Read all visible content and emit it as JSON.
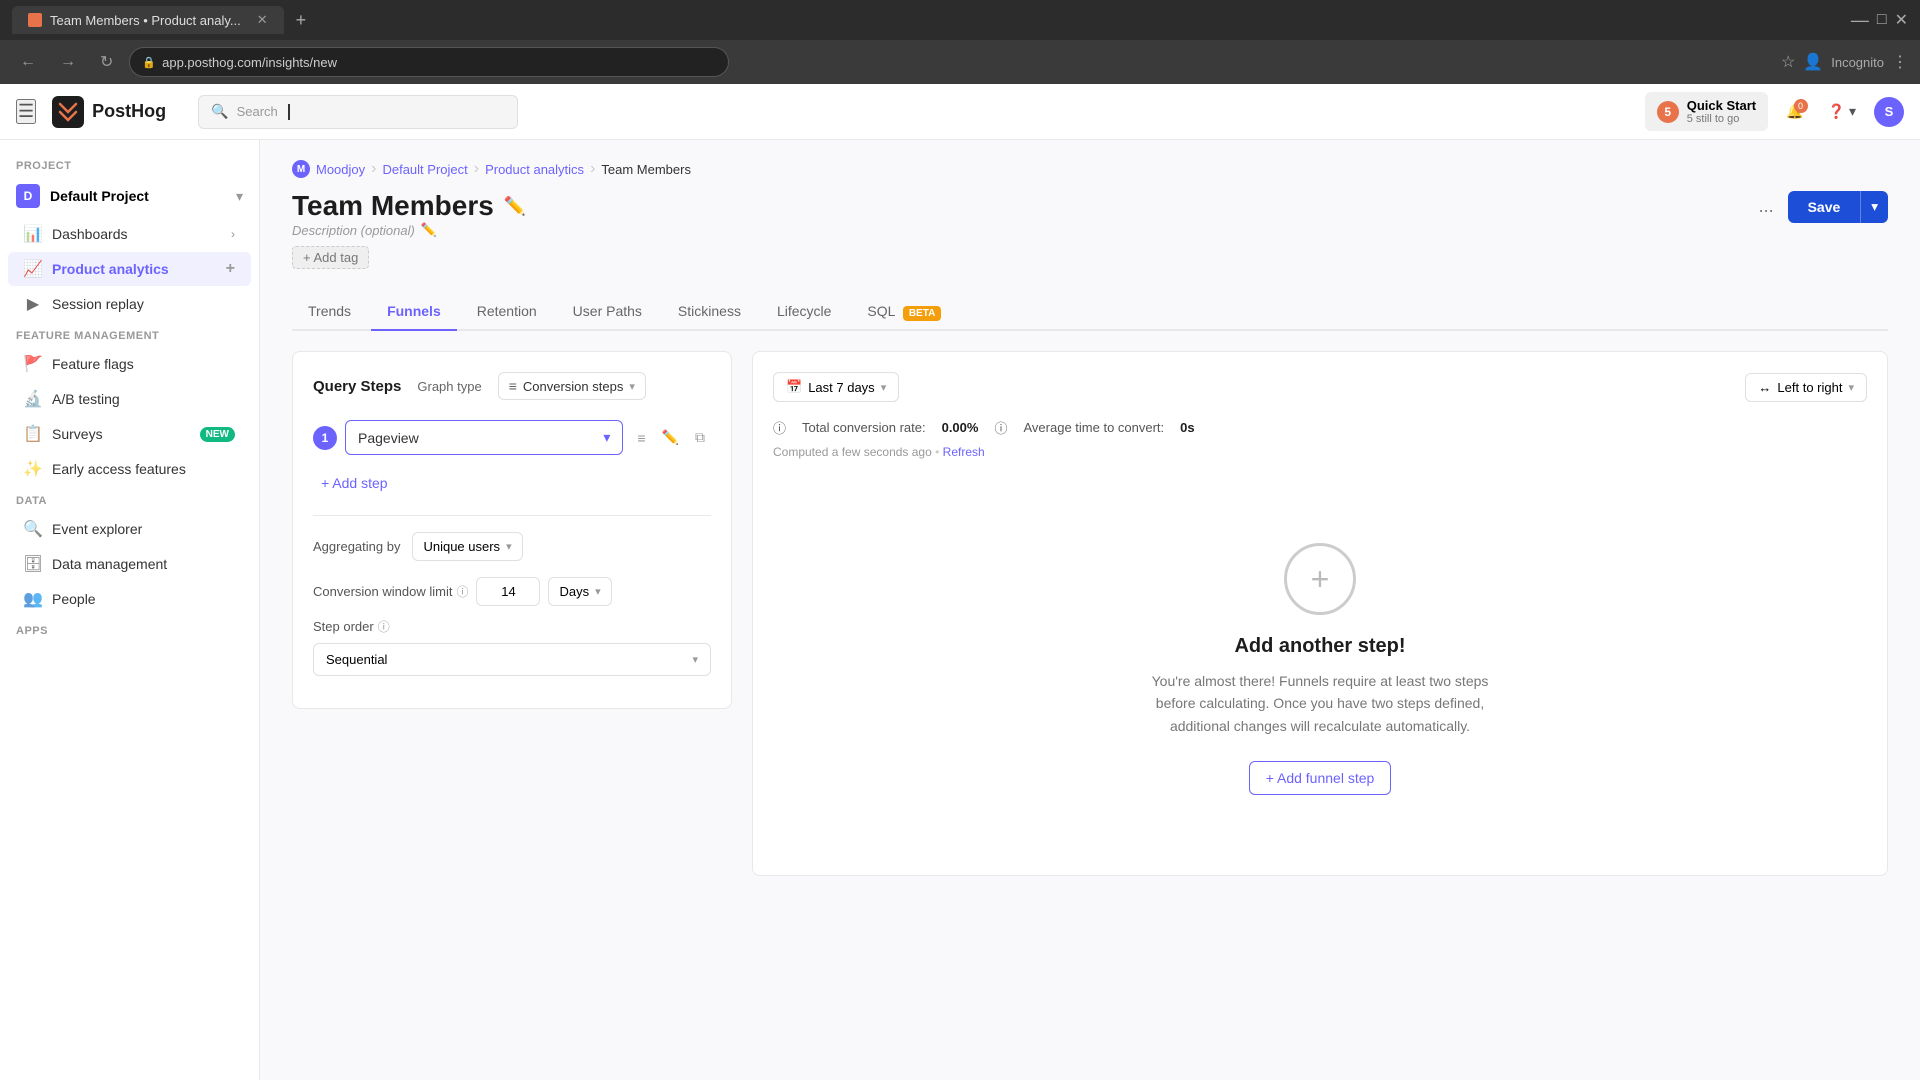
{
  "browser": {
    "tab_title": "Team Members • Product analy...",
    "address": "app.posthog.com/insights/new",
    "incognito_label": "Incognito"
  },
  "topbar": {
    "logo_text": "PostHog",
    "search_placeholder": "Search...",
    "search_label": "Search",
    "quick_start_label": "Quick Start",
    "quick_start_sub": "5 still to go",
    "quick_start_count": "5",
    "notification_count": "0",
    "help_label": "Help",
    "avatar_initials": "S"
  },
  "sidebar": {
    "project_section": "PROJECT",
    "project_name": "Default Project",
    "project_initial": "D",
    "nav_items": [
      {
        "id": "dashboards",
        "label": "Dashboards",
        "icon": "📊"
      },
      {
        "id": "product-analytics",
        "label": "Product analytics",
        "icon": "📈",
        "active": true
      }
    ],
    "session_replay": {
      "label": "Session replay",
      "icon": "▶"
    },
    "feature_management_section": "FEATURE MANAGEMENT",
    "feature_flags": {
      "label": "Feature flags",
      "icon": "🚩"
    },
    "ab_testing": {
      "label": "A/B testing",
      "icon": "🔬"
    },
    "surveys": {
      "label": "Surveys",
      "icon": "📋",
      "badge": "NEW"
    },
    "early_access": {
      "label": "Early access features",
      "icon": "✨"
    },
    "data_section": "DATA",
    "event_explorer": {
      "label": "Event explorer",
      "icon": "🔍"
    },
    "data_management": {
      "label": "Data management",
      "icon": "🗄"
    },
    "people": {
      "label": "People",
      "icon": "👥"
    },
    "apps_section": "APPS"
  },
  "breadcrumb": {
    "project_icon": "M",
    "project_name": "Moodjoy",
    "default_project": "Default Project",
    "product_analytics": "Product analytics",
    "current": "Team Members"
  },
  "page": {
    "title": "Team Members",
    "description_placeholder": "Description (optional)",
    "add_tag_label": "+ Add tag"
  },
  "header_actions": {
    "more_label": "...",
    "save_label": "Save"
  },
  "tabs": [
    {
      "id": "trends",
      "label": "Trends",
      "active": false
    },
    {
      "id": "funnels",
      "label": "Funnels",
      "active": true
    },
    {
      "id": "retention",
      "label": "Retention",
      "active": false
    },
    {
      "id": "user-paths",
      "label": "User Paths",
      "active": false
    },
    {
      "id": "stickiness",
      "label": "Stickiness",
      "active": false
    },
    {
      "id": "lifecycle",
      "label": "Lifecycle",
      "active": false
    },
    {
      "id": "sql",
      "label": "SQL",
      "active": false,
      "badge": "BETA"
    }
  ],
  "query": {
    "steps_label": "Query Steps",
    "graph_type_label": "Graph type",
    "conversion_steps_label": "Conversion steps",
    "step_1": {
      "number": "1",
      "value": "Pageview"
    },
    "add_step_label": "+ Add step",
    "aggregating_label": "Aggregating by",
    "aggregating_value": "Unique users",
    "conversion_window_label": "Conversion window limit",
    "conversion_window_value": "14",
    "conversion_window_unit": "Days",
    "step_order_label": "Step order",
    "step_order_value": "Sequential"
  },
  "results": {
    "date_range": "Last 7 days",
    "direction": "Left to right",
    "conversion_rate_label": "Total conversion rate:",
    "conversion_rate_value": "0.00%",
    "avg_time_label": "Average time to convert:",
    "avg_time_value": "0s",
    "computed_label": "Computed a few seconds ago",
    "refresh_label": "Refresh",
    "add_step_title": "Add another step!",
    "add_step_desc": "You're almost there! Funnels require at least two steps before calculating. Once you have two steps defined, additional changes will recalculate automatically.",
    "add_funnel_step_label": "+ Add funnel step"
  }
}
